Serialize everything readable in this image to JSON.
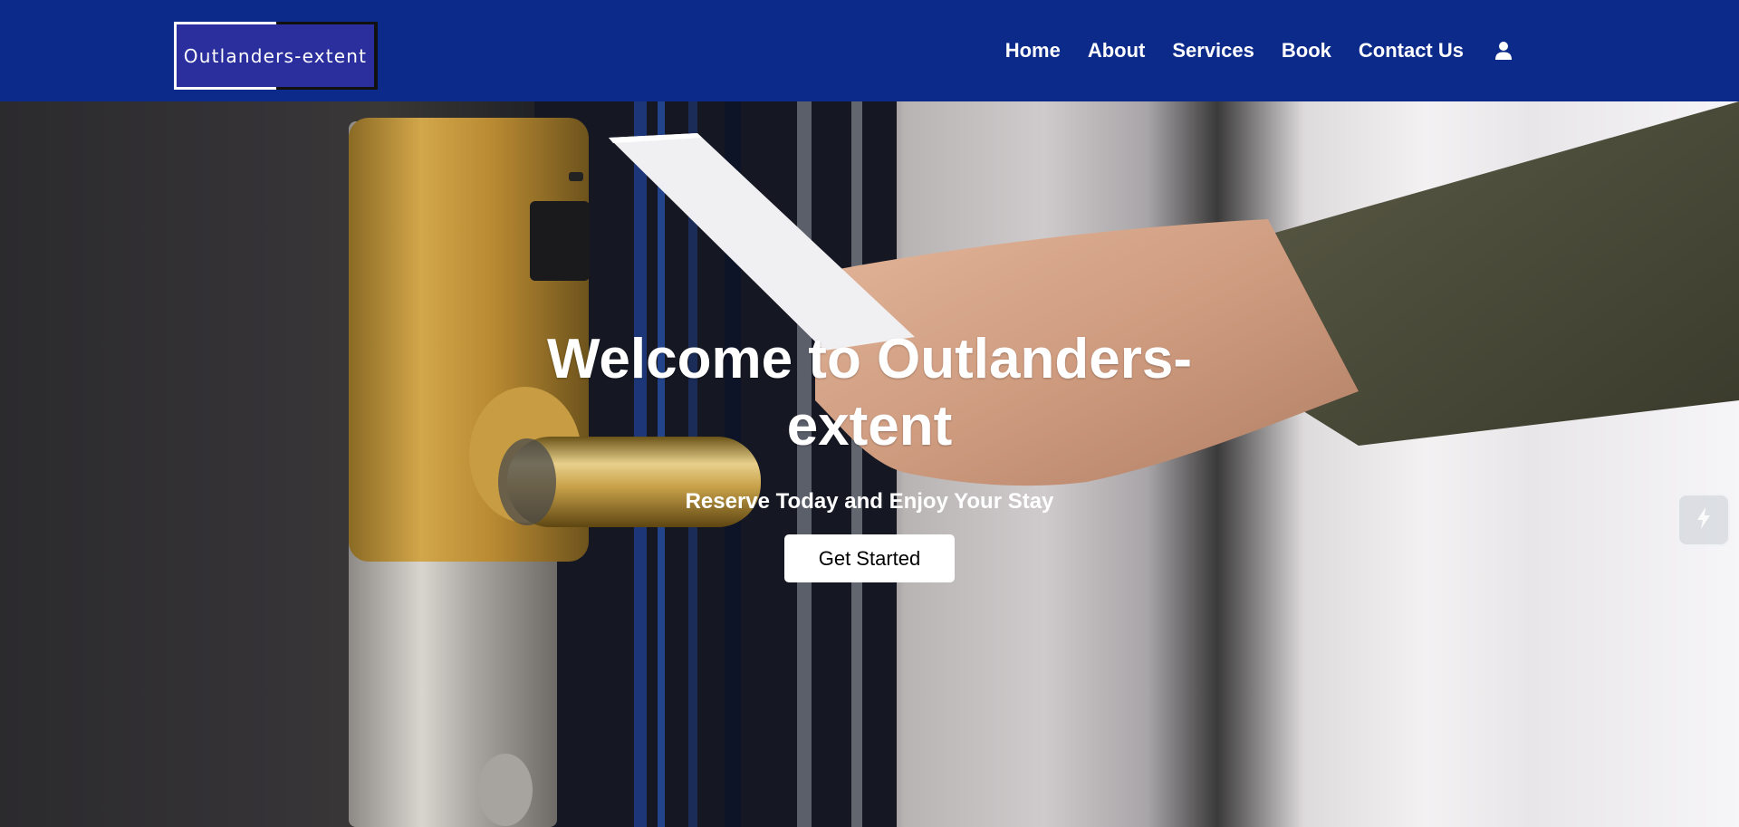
{
  "header": {
    "logo_text": "Outlanders-extent",
    "nav": {
      "home": "Home",
      "about": "About",
      "services": "Services",
      "book": "Book",
      "contact": "Contact Us"
    },
    "user_icon": "user-icon"
  },
  "hero": {
    "title": "Welcome to Outlanders-extent",
    "subtitle": "Reserve Today and Enjoy Your Stay",
    "cta_label": "Get Started",
    "background_description_icon": "hotel-keycard-door-photo"
  },
  "side_widget": {
    "icon": "lightning-bolt-icon"
  },
  "colors": {
    "header_bg": "#0c2a8a",
    "logo_bg": "#2b2f9e",
    "text": "#ffffff",
    "cta_bg": "#ffffff",
    "cta_text": "#000000"
  }
}
